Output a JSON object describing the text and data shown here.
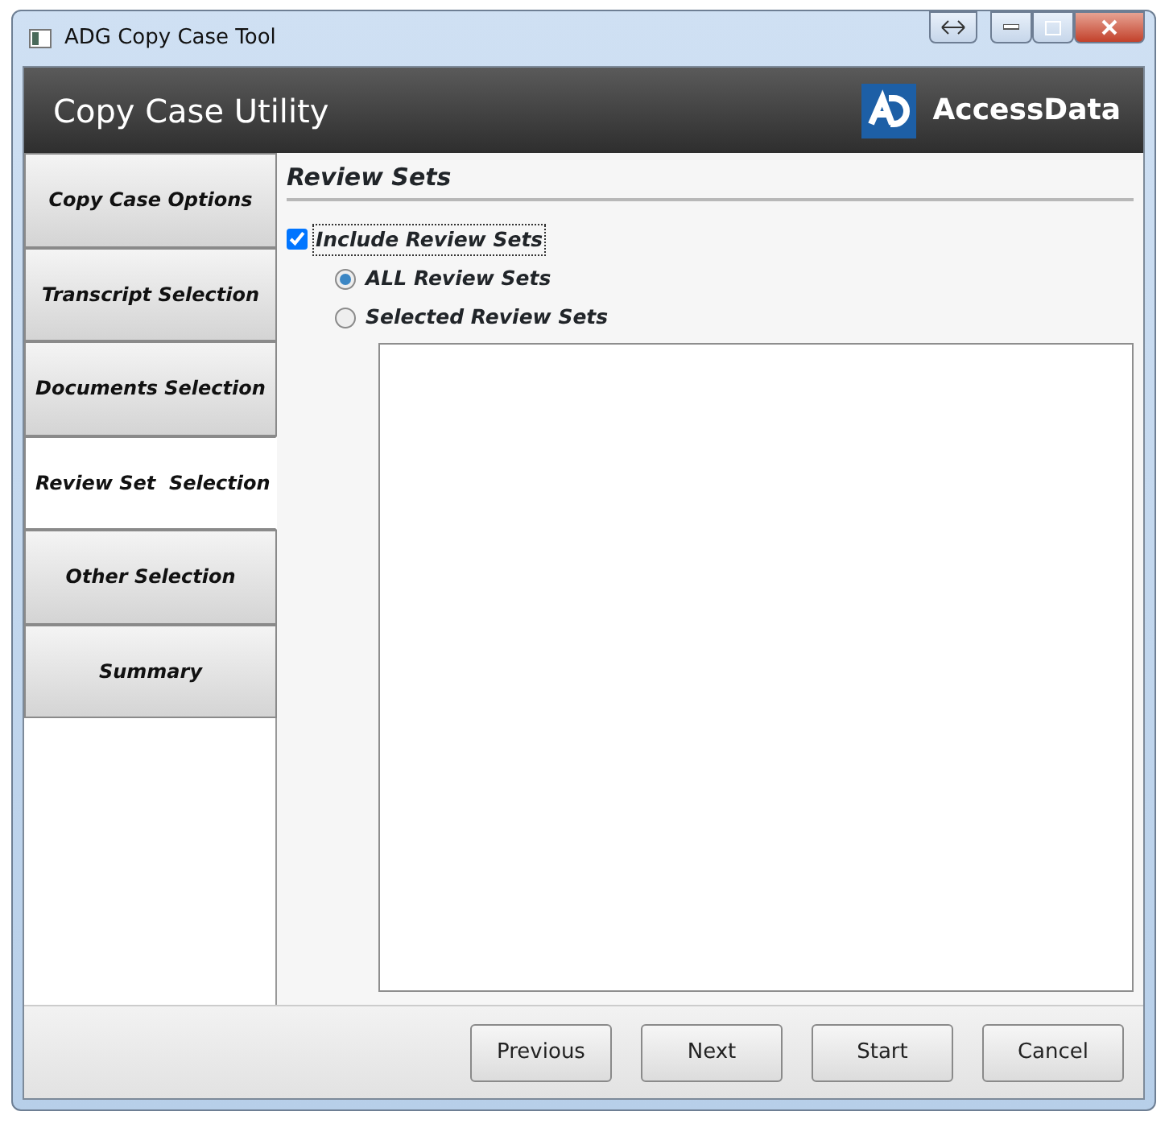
{
  "window": {
    "title": "ADG Copy Case Tool"
  },
  "header": {
    "title": "Copy Case Utility",
    "brand": "AccessData"
  },
  "tabs": [
    {
      "label": "Copy Case Options",
      "selected": false
    },
    {
      "label": "Transcript Selection",
      "selected": false
    },
    {
      "label": "Documents Selection",
      "selected": false
    },
    {
      "label": "Review Set  Selection",
      "selected": true
    },
    {
      "label": "Other Selection",
      "selected": false
    },
    {
      "label": "Summary",
      "selected": false
    }
  ],
  "section": {
    "title": "Review Sets",
    "include": {
      "label": "Include Review Sets",
      "checked": true
    },
    "options": [
      {
        "label": "ALL Review Sets",
        "selected": true
      },
      {
        "label": "Selected Review Sets",
        "selected": false
      }
    ]
  },
  "buttons": [
    "Previous",
    "Next",
    "Start",
    "Cancel"
  ]
}
